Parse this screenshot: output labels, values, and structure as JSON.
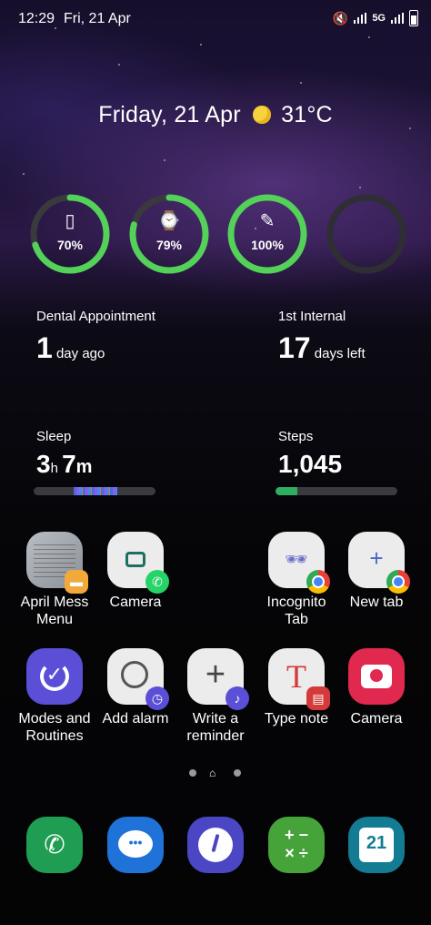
{
  "status_bar": {
    "time": "12:29",
    "date": "Fri, 21 Apr",
    "network": "5G"
  },
  "weather": {
    "text": "Friday, 21 Apr",
    "temperature": "31°C"
  },
  "batteries": [
    {
      "device": "phone",
      "icon": "📱",
      "percent_label": "70%",
      "level": 0.7,
      "color": "#53d159"
    },
    {
      "device": "watch",
      "icon": "⌚",
      "percent_label": "79%",
      "level": 0.79,
      "color": "#53d159"
    },
    {
      "device": "s-pen",
      "icon": "✏",
      "percent_label": "100%",
      "level": 1.0,
      "color": "#53d159"
    },
    {
      "device": "empty",
      "icon": "",
      "percent_label": "",
      "level": 0,
      "color": "#3a3a3e"
    }
  ],
  "events": [
    {
      "title": "Dental Appointment",
      "value": "1",
      "unit": "day ago"
    },
    {
      "title": "1st Internal",
      "value": "17",
      "unit": "days left"
    }
  ],
  "health": {
    "sleep": {
      "title": "Sleep",
      "hours": "3",
      "h_unit": "h",
      "minutes": "7",
      "m_unit": "m"
    },
    "steps": {
      "title": "Steps",
      "value": "1,045",
      "goal_fraction": 0.18
    }
  },
  "apps_row1": [
    {
      "label": "April Mess Menu",
      "icon": "menu-photo-icon",
      "badge": "folder-icon"
    },
    {
      "label": "Camera",
      "icon": "camera-icon",
      "badge": "whatsapp-icon"
    },
    {
      "label": "Incognito Tab",
      "icon": "incognito-icon",
      "badge": "chrome-icon"
    },
    {
      "label": "New tab",
      "icon": "plus-icon",
      "badge": "chrome-icon"
    }
  ],
  "apps_row2": [
    {
      "label": "Modes and Routines",
      "icon": "modes-routines-icon"
    },
    {
      "label": "Add alarm",
      "icon": "alarm-icon"
    },
    {
      "label": "Write a reminder",
      "icon": "reminder-icon"
    },
    {
      "label": "Type note",
      "icon": "type-note-icon"
    },
    {
      "label": "Camera",
      "icon": "camera-icon"
    }
  ],
  "dock": [
    {
      "name": "phone",
      "icon": "phone-icon"
    },
    {
      "name": "messages",
      "icon": "messages-icon"
    },
    {
      "name": "clock",
      "icon": "clock-icon"
    },
    {
      "name": "calculator",
      "icon": "calculator-icon",
      "glyph": "+−\n×÷"
    },
    {
      "name": "calendar",
      "icon": "calendar-icon",
      "day": "21"
    }
  ],
  "page_indicator": {
    "pages": 3,
    "current": 2
  }
}
